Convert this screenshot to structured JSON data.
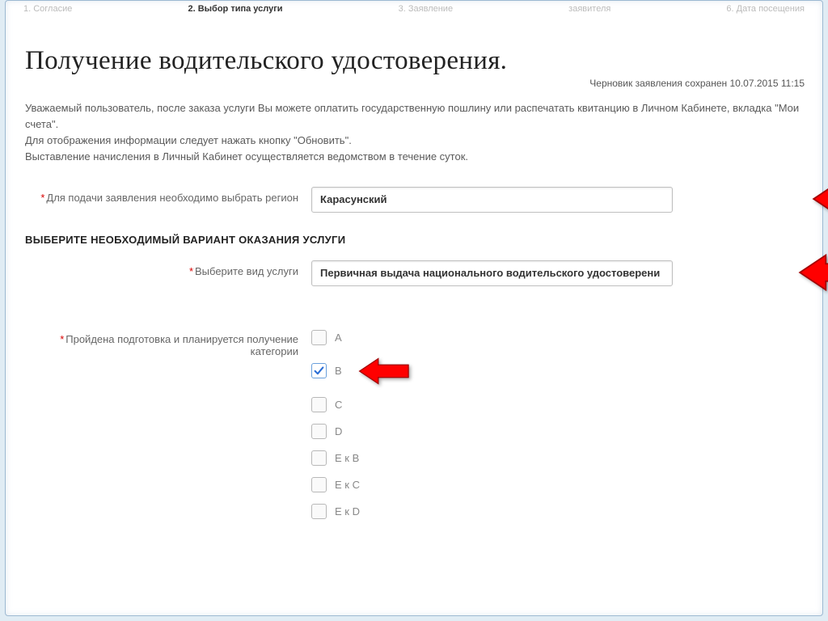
{
  "steps": {
    "s1": "1. Согласие",
    "s2": "2. Выбор типа услуги",
    "s3": "3. Заявление",
    "s4": "заявителя",
    "s5": "6. Дата посещения"
  },
  "title": "Получение водительского удостоверения.",
  "draft": "Черновик заявления сохранен 10.07.2015 11:15",
  "intro_l1": "Уважаемый пользователь, после заказа услуги Вы можете оплатить государственную пошлину или распечатать квитанцию в Личном Кабинете, вкладка \"Мои счета\".",
  "intro_l2": "Для отображения информации следует нажать кнопку \"Обновить\".",
  "intro_l3": "Выставление начисления в Личный Кабинет осуществляется ведомством в течение суток.",
  "region": {
    "label": "Для подачи заявления необходимо выбрать регион",
    "value": "Карасунский"
  },
  "section_head": "ВЫБЕРИТЕ НЕОБХОДИМЫЙ ВАРИАНТ ОКАЗАНИЯ УСЛУГИ",
  "service": {
    "label": "Выберите вид услуги",
    "value": "Первичная выдача национального водительского удостоверени"
  },
  "category": {
    "label": "Пройдена подготовка и планируется получение категории",
    "options": [
      {
        "label": "A",
        "checked": false
      },
      {
        "label": "B",
        "checked": true
      },
      {
        "label": "C",
        "checked": false
      },
      {
        "label": "D",
        "checked": false
      },
      {
        "label": "E к B",
        "checked": false
      },
      {
        "label": "E к C",
        "checked": false
      },
      {
        "label": "E к D",
        "checked": false
      }
    ]
  }
}
